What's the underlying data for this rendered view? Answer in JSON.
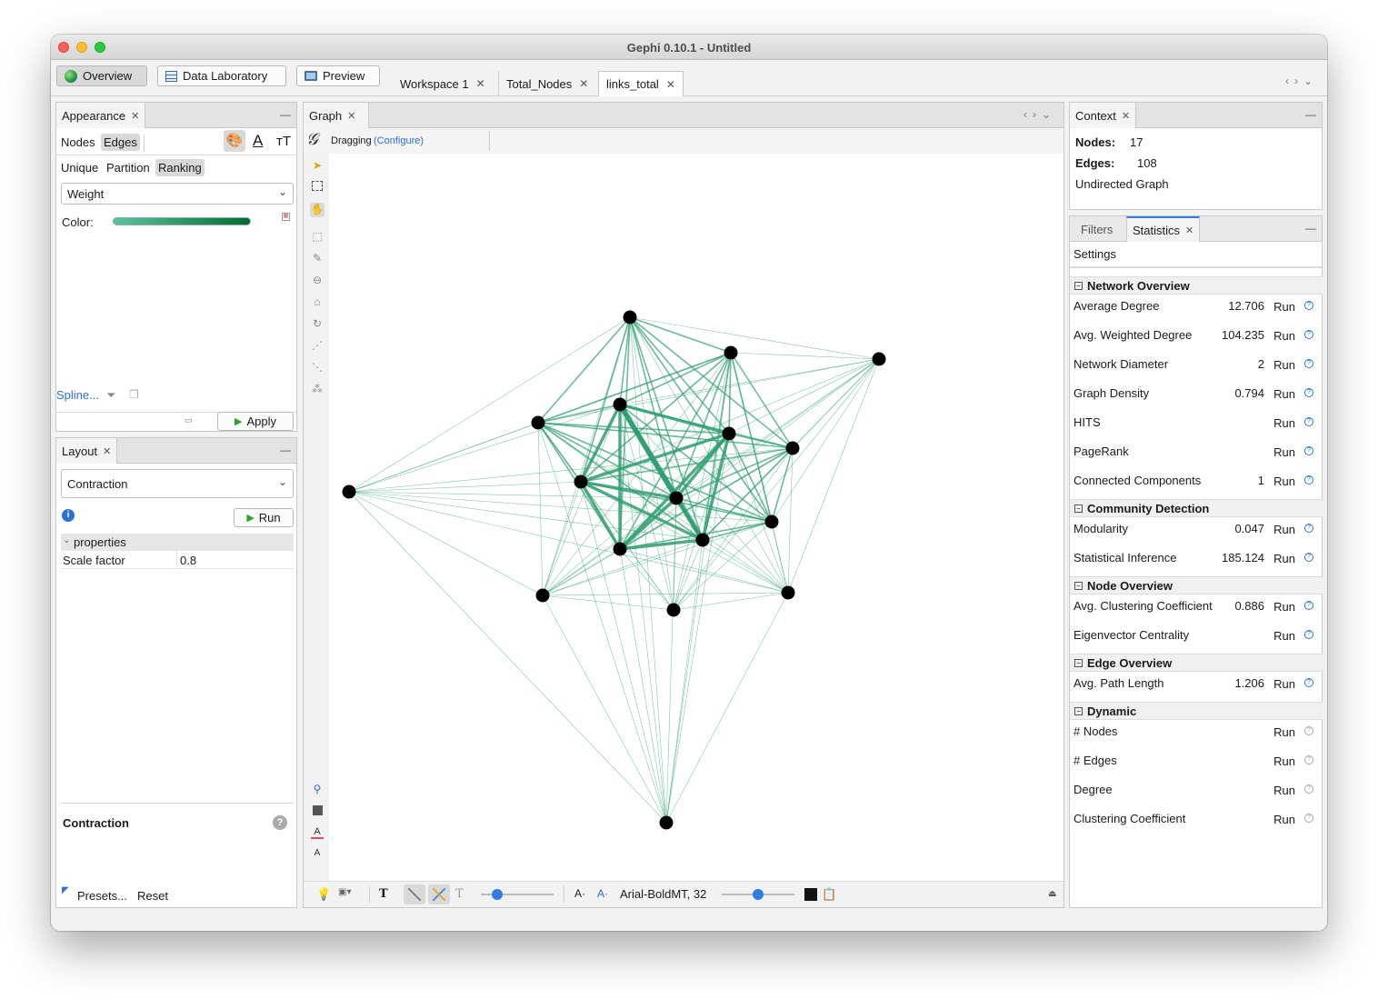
{
  "window": {
    "title": "Gephi 0.10.1 - Untitled"
  },
  "toolbar": {
    "modes": [
      {
        "label": "Overview",
        "active": true
      },
      {
        "label": "Data Laboratory",
        "active": false
      },
      {
        "label": "Preview",
        "active": false
      }
    ],
    "workspaces": [
      {
        "label": "Workspace 1",
        "active": false
      },
      {
        "label": "Total_Nodes",
        "active": false
      },
      {
        "label": "links_total",
        "active": true
      }
    ]
  },
  "appearance": {
    "tab_label": "Appearance",
    "element_tabs": [
      "Nodes",
      "Edges"
    ],
    "selected_element": "Edges",
    "mode_tabs": [
      "Unique",
      "Partition",
      "Ranking"
    ],
    "selected_mode": "Ranking",
    "attribute": "Weight",
    "color_label": "Color:",
    "gradient_start": "#5cc49a",
    "gradient_end": "#006d2c",
    "spline_label": "Spline...",
    "apply_label": "Apply"
  },
  "layout": {
    "tab_label": "Layout",
    "algorithm": "Contraction",
    "run_label": "Run",
    "properties_header": "properties",
    "properties": [
      {
        "name": "Scale factor",
        "value": "0.8"
      }
    ],
    "description_title": "Contraction",
    "presets_label": "Presets...",
    "reset_label": "Reset"
  },
  "graph": {
    "tab_label": "Graph",
    "mode_label": "Dragging",
    "configure_label": "(Configure)",
    "edge_color": "#2e9e6e",
    "node_color": "#000000",
    "font_label": "Arial-BoldMT, 32"
  },
  "context": {
    "tab_label": "Context",
    "nodes_label": "Nodes:",
    "nodes_value": "17",
    "edges_label": "Edges:",
    "edges_value": "108",
    "graph_type": "Undirected Graph"
  },
  "statistics": {
    "tabs": [
      "Filters",
      "Statistics"
    ],
    "active_tab": "Statistics",
    "settings_label": "Settings",
    "run_label": "Run",
    "sections": [
      {
        "title": "Network Overview",
        "rows": [
          {
            "label": "Average Degree",
            "value": "12.706"
          },
          {
            "label": "Avg. Weighted Degree",
            "value": "104.235"
          },
          {
            "label": "Network Diameter",
            "value": "2"
          },
          {
            "label": "Graph Density",
            "value": "0.794"
          },
          {
            "label": "HITS",
            "value": ""
          },
          {
            "label": "PageRank",
            "value": ""
          },
          {
            "label": "Connected Components",
            "value": "1"
          }
        ]
      },
      {
        "title": "Community Detection",
        "rows": [
          {
            "label": "Modularity",
            "value": "0.047"
          },
          {
            "label": "Statistical Inference",
            "value": "185.124"
          }
        ]
      },
      {
        "title": "Node Overview",
        "rows": [
          {
            "label": "Avg. Clustering Coefficient",
            "value": "0.886"
          },
          {
            "label": "Eigenvector Centrality",
            "value": ""
          }
        ]
      },
      {
        "title": "Edge Overview",
        "rows": [
          {
            "label": "Avg. Path Length",
            "value": "1.206"
          }
        ]
      },
      {
        "title": "Dynamic",
        "rows": [
          {
            "label": "# Nodes",
            "value": ""
          },
          {
            "label": "# Edges",
            "value": ""
          },
          {
            "label": "Degree",
            "value": ""
          },
          {
            "label": "Clustering Coefficient",
            "value": ""
          }
        ]
      }
    ]
  }
}
